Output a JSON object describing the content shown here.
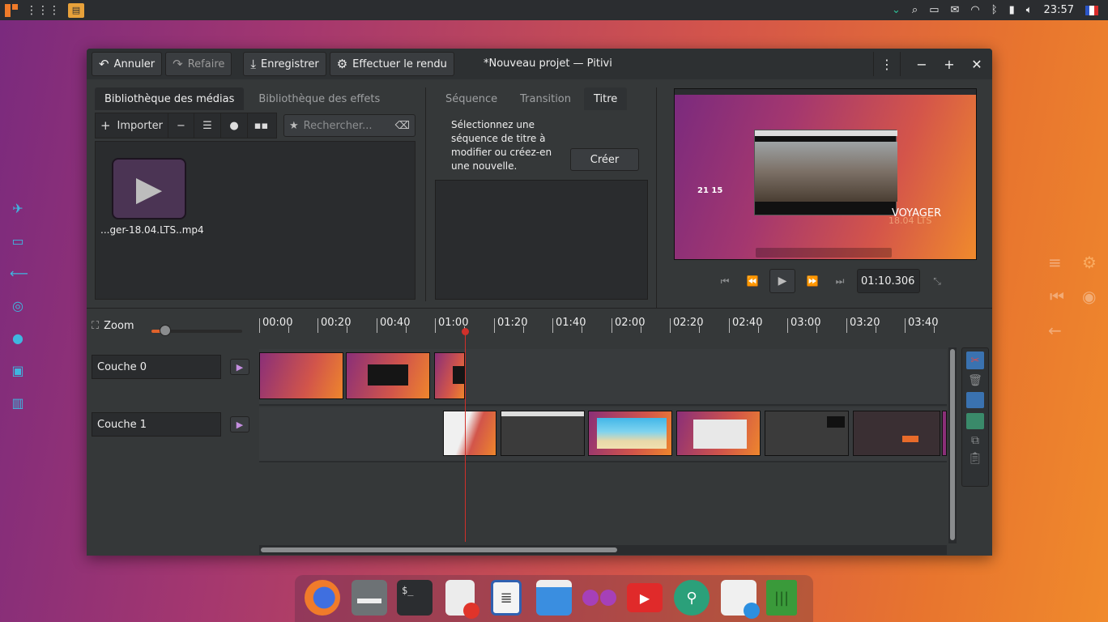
{
  "topbar": {
    "clock": "23:57",
    "icons": [
      "apps-icon",
      "grid-icon",
      "app-indicator-icon",
      "chevron-down-icon",
      "search-icon",
      "files-icon",
      "mail-icon",
      "wifi-icon",
      "bluetooth-icon",
      "battery-icon",
      "volume-icon",
      "flag-fr-icon"
    ]
  },
  "window": {
    "title": "*Nouveau projet — Pitivi",
    "header": {
      "undo_label": "Annuler",
      "redo_label": "Refaire",
      "save_label": "Enregistrer",
      "render_label": "Effectuer le rendu"
    }
  },
  "media_panel": {
    "tabs": [
      {
        "label": "Bibliothèque des médias",
        "active": true
      },
      {
        "label": "Bibliothèque des effets",
        "active": false
      }
    ],
    "import_label": "Importer",
    "search_placeholder": "Rechercher...",
    "items": [
      {
        "label": "...ger-18.04.LTS..mp4"
      }
    ]
  },
  "clip_panel": {
    "tabs": [
      {
        "label": "Séquence",
        "active": false
      },
      {
        "label": "Transition",
        "active": false
      },
      {
        "label": "Titre",
        "active": true
      }
    ],
    "hint": "Sélectionnez une séquence de titre à modifier ou créez-en une nouvelle.",
    "create_label": "Créer"
  },
  "viewer": {
    "timecode": "01:10.306",
    "preview_text": {
      "big_time": "21 15",
      "brand": "VOYAGER",
      "version": "18.04 LTS"
    }
  },
  "timeline": {
    "zoom_label": "Zoom",
    "ruler": [
      "00:00",
      "00:20",
      "00:40",
      "01:00",
      "01:20",
      "01:40",
      "02:00",
      "02:20",
      "02:40",
      "03:00",
      "03:20",
      "03:40"
    ],
    "layers": [
      {
        "name": "Couche 0"
      },
      {
        "name": "Couche 1"
      }
    ]
  },
  "dock": {
    "apps": [
      "firefox-icon",
      "files-icon",
      "terminal-icon",
      "text-editor-icon",
      "writer-icon",
      "window-icon",
      "gnome-twitch-icon",
      "youtube-icon",
      "settings-icon",
      "software-install-icon",
      "trash-icon"
    ]
  }
}
